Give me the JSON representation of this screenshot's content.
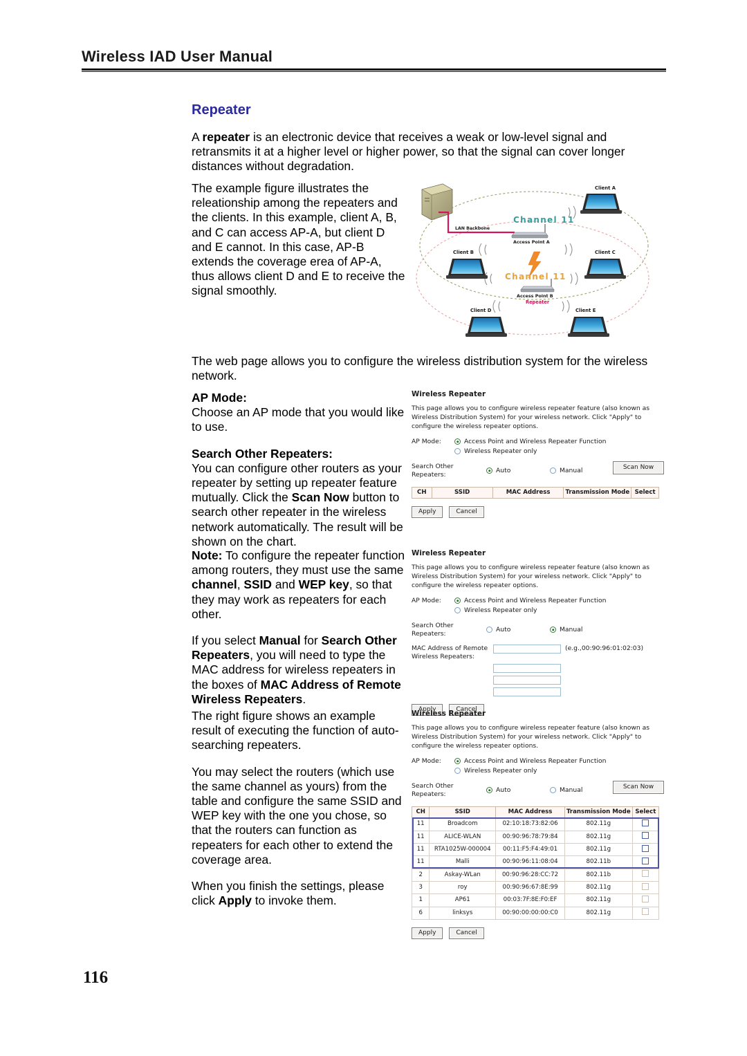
{
  "header": {
    "running_title": "Wireless IAD User Manual"
  },
  "section": {
    "heading": "Repeater"
  },
  "body": {
    "intro_1": "A ",
    "intro_bold": "repeater",
    "intro_2": " is an electronic device that receives a weak or low-level signal and retransmits it at a higher level or higher power, so that the signal can cover longer distances without degradation.",
    "figure_para": "The example figure illustrates the releationship among the repeaters and the clients. In this example, client A, B, and C can access AP-A, but client D and E cannot. In this case, AP-B extends the coverage erea of AP-A, thus allows client D and E to receive the signal smoothly.",
    "webpage_para": "The web page allows you to configure the wireless distribution system for the wireless network.",
    "ap_mode_label": "AP Mode:",
    "ap_mode_para": "Choose an AP mode that you would like to use.",
    "search_label": "Search Other Repeaters:",
    "search_para_1": "You can configure other routers as your repeater by setting up repeater feature mutually. Click the ",
    "search_para_bold": "Scan Now",
    "search_para_2": " button to search other repeater in the wireless network automatically. The result will be shown on the chart.",
    "note_label": "Note:",
    "note_1": "  To configure the repeater function among routers, they must use the same ",
    "note_b1": "channel",
    "note_2": ", ",
    "note_b2": "SSID",
    "note_3": " and ",
    "note_b3": "WEP key",
    "note_4": ", so that they may work as repeaters for each other.",
    "manual_1": "If you select ",
    "manual_b1": "Manual",
    "manual_2": " for ",
    "manual_b2": "Search Other Repeaters",
    "manual_3": ", you will need to type the MAC address for wireless repeaters in the boxes of ",
    "manual_b3": "MAC Address of Remote Wireless Repeaters",
    "manual_4": ".",
    "right_fig_para": "The right figure shows an example result of executing the function of auto-searching repeaters.",
    "select_para": "You may select the routers (which use the same channel as yours) from the table and configure the same SSID and WEP key with the one you chose, so that the routers can function as repeaters for each other to extend the coverage area.",
    "apply_1": "When you finish the settings, please click ",
    "apply_bold": "Apply",
    "apply_2": " to invoke them."
  },
  "figure": {
    "channel_outer": "Channel 11",
    "channel_inner": "Channel 11",
    "lan_backbone": "LAN Backbone",
    "ap_a": "Access Point A",
    "ap_b": "Access Point B",
    "repeater_tag": "Repeater",
    "client_a": "Client A",
    "client_b": "Client B",
    "client_c": "Client C",
    "client_d": "Client D",
    "client_e": "Client E",
    "colors": {
      "outer_ellipse": "#9aa36a",
      "inner_ellipse": "#e8a3a3",
      "cable": "#d4145a",
      "channel_outer_text": "#3a9c9c",
      "channel_inner_text": "#e8a33d",
      "repeater_text": "#d4145a",
      "laptop_screen": "#2f9ed6"
    }
  },
  "panels": {
    "common": {
      "title": "Wireless Repeater",
      "description": "This page allows you to configure wireless repeater feature (also known as Wireless Distribution System) for your wireless network. Click \"Apply\" to configure the wireless repeater options.",
      "ap_mode_label": "AP Mode:",
      "ap_mode_option_1": "Access Point and Wireless Repeater Function",
      "ap_mode_option_2": "Wireless Repeater only",
      "search_label": "Search Other Repeaters:",
      "search_option_auto": "Auto",
      "search_option_manual": "Manual",
      "scan_now_button": "Scan Now",
      "apply_button": "Apply",
      "cancel_button": "Cancel",
      "mac_label_line1": "MAC Address of Remote",
      "mac_label_line2": "Wireless Repeaters:",
      "mac_hint": "(e.g.,00:90:96:01:02:03)",
      "mac_input_value": ""
    },
    "table_headers": {
      "ch": "CH",
      "ssid": "SSID",
      "mac": "MAC Address",
      "mode": "Transmission Mode",
      "select": "Select"
    },
    "panel1": {
      "selected_ap_mode": "Access Point and Wireless Repeater Function",
      "selected_search": "Auto",
      "rows": []
    },
    "panel2": {
      "selected_ap_mode": "Access Point and Wireless Repeater Function",
      "selected_search": "Manual",
      "mac_inputs": [
        "",
        "",
        "",
        ""
      ]
    },
    "panel3": {
      "selected_ap_mode": "Access Point and Wireless Repeater Function",
      "selected_search": "Auto",
      "rows": [
        {
          "ch": "11",
          "ssid": "Broadcom",
          "mac": "02:10:18:73:82:06",
          "mode": "802.11g",
          "selected": false,
          "highlighted": true
        },
        {
          "ch": "11",
          "ssid": "ALICE-WLAN",
          "mac": "00:90:96:78:79:84",
          "mode": "802.11g",
          "selected": false,
          "highlighted": true
        },
        {
          "ch": "11",
          "ssid": "RTA1025W-000004",
          "mac": "00:11:F5:F4:49:01",
          "mode": "802.11g",
          "selected": false,
          "highlighted": true
        },
        {
          "ch": "11",
          "ssid": "Malli",
          "mac": "00:90:96:11:08:04",
          "mode": "802.11b",
          "selected": false,
          "highlighted": true
        },
        {
          "ch": "2",
          "ssid": "Askay-WLan",
          "mac": "00:90:96:28:CC:72",
          "mode": "802.11b",
          "selected": false,
          "highlighted": false
        },
        {
          "ch": "3",
          "ssid": "roy",
          "mac": "00:90:96:67:8E:99",
          "mode": "802.11g",
          "selected": false,
          "highlighted": false
        },
        {
          "ch": "1",
          "ssid": "AP61",
          "mac": "00:03:7F:8E:F0:EF",
          "mode": "802.11g",
          "selected": false,
          "highlighted": false
        },
        {
          "ch": "6",
          "ssid": "linksys",
          "mac": "00:90:00:00:00:C0",
          "mode": "802.11g",
          "selected": false,
          "highlighted": false
        }
      ]
    }
  },
  "footer": {
    "page_number": "116"
  }
}
